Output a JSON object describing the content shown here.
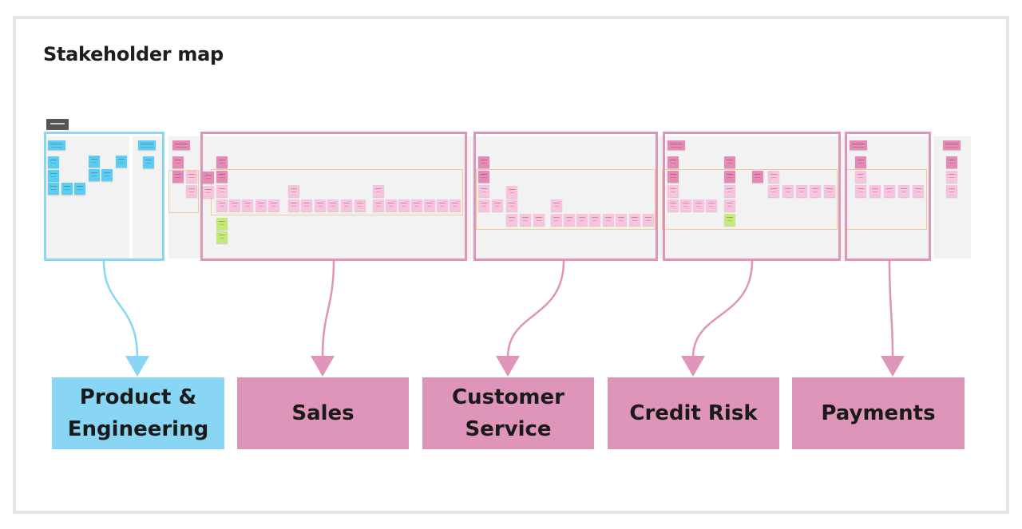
{
  "title": "Stakeholder map",
  "colors": {
    "engineering": "#89d6f4",
    "business": "#de95b9",
    "band": "#f5c89a",
    "board": "#f2f2f2",
    "frame_outline": "#e4e4e4"
  },
  "board": {
    "groups": [
      {
        "id": "product-engineering",
        "color": "blue",
        "sticky_count": 14
      },
      {
        "id": "sales",
        "color": "pink",
        "sticky_count": 34
      },
      {
        "id": "customer-service",
        "color": "pink",
        "sticky_count": 21
      },
      {
        "id": "credit-risk",
        "color": "pink",
        "sticky_count": 22
      },
      {
        "id": "payments",
        "color": "pink",
        "sticky_count": 9,
        "readable_sticky_text": "Muriel Quann"
      }
    ]
  },
  "labels": [
    {
      "line1": "Product &",
      "line2": "Engineering",
      "color": "blue"
    },
    {
      "line1": "Sales",
      "line2": "",
      "color": "pink"
    },
    {
      "line1": "Customer",
      "line2": "Service",
      "color": "pink"
    },
    {
      "line1": "Credit Risk",
      "line2": "",
      "color": "pink"
    },
    {
      "line1": "Payments",
      "line2": "",
      "color": "pink"
    }
  ]
}
